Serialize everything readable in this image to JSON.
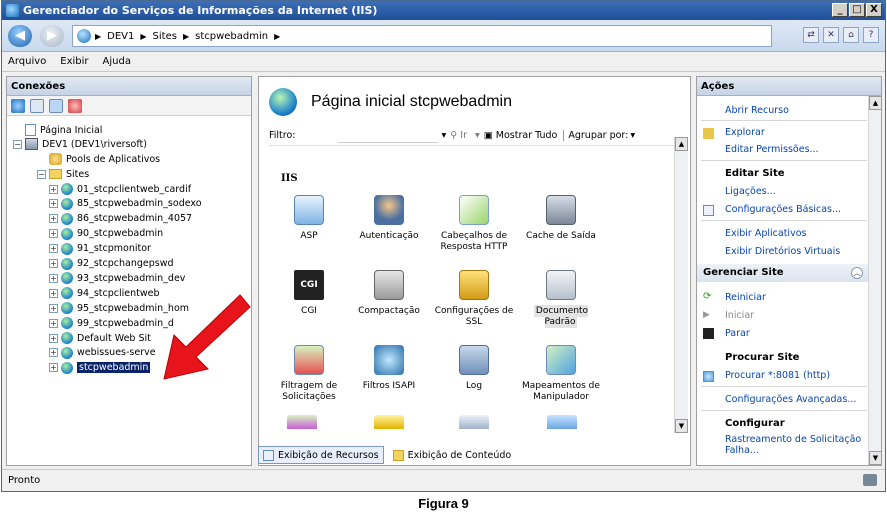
{
  "window": {
    "title": "Gerenciador do Serviços de Informações da Internet (IIS)",
    "controls": [
      "_",
      "□",
      "X"
    ]
  },
  "address": {
    "segments": [
      "DEV1",
      "Sites",
      "stcpwebadmin"
    ]
  },
  "menu": [
    "Arquivo",
    "Exibir",
    "Ajuda"
  ],
  "connections": {
    "title": "Conexões",
    "tree": {
      "start_page": "Página Inicial",
      "server": "DEV1 (DEV1\\riversoft)",
      "app_pools": "Pools de Aplicativos",
      "sites_folder": "Sites",
      "sites": [
        "01_stcpclientweb_cardif",
        "85_stcpwebadmin_sodexo",
        "86_stcpwebadmin_4057",
        "90_stcpwebadmin",
        "91_stcpmonitor",
        "92_stcpchangepswd",
        "93_stcpwebadmin_dev",
        "94_stcpclientweb",
        "95_stcpwebadmin_hom",
        "99_stcpwebadmin_d",
        "Default Web Sit",
        "webissues-serve",
        "stcpwebadmin"
      ],
      "selected": "stcpwebadmin"
    }
  },
  "center": {
    "title": "Página inicial stcpwebadmin",
    "filter_label": "Filtro:",
    "go_label": "Ir",
    "show_all_label": "Mostrar Tudo",
    "group_by_label": "Agrupar por:",
    "section": "IIS",
    "features": [
      {
        "label": "ASP",
        "icon": "asp-icon"
      },
      {
        "label": "Autenticação",
        "icon": "authentication-icon"
      },
      {
        "label": "Cabeçalhos de Resposta HTTP",
        "icon": "http-headers-icon"
      },
      {
        "label": "Cache de Saída",
        "icon": "output-cache-icon"
      },
      {
        "label": "CGI",
        "icon": "cgi-icon"
      },
      {
        "label": "Compactação",
        "icon": "compression-icon"
      },
      {
        "label": "Configurações de SSL",
        "icon": "ssl-lock-icon"
      },
      {
        "label": "Documento Padrão",
        "icon": "default-document-icon"
      },
      {
        "label": "Filtragem de Solicitações",
        "icon": "request-filtering-icon"
      },
      {
        "label": "Filtros ISAPI",
        "icon": "isapi-filters-icon"
      },
      {
        "label": "Log",
        "icon": "log-icon"
      },
      {
        "label": "Mapeamentos de Manipulador",
        "icon": "handler-mappings-icon"
      }
    ],
    "cgi_text": "CGI",
    "selected_feature": "Documento Padrão",
    "view_tabs": [
      "Exibição de Recursos",
      "Exibição de Conteúdo"
    ]
  },
  "actions": {
    "title": "Ações",
    "items": {
      "open_feature": "Abrir Recurso",
      "explore": "Explorar",
      "edit_permissions": "Editar Permissões...",
      "edit_site_head": "Editar Site",
      "bindings": "Ligações...",
      "basic_settings": "Configurações Básicas...",
      "view_apps": "Exibir Aplicativos",
      "view_vdirs": "Exibir Diretórios Virtuais",
      "manage_site_group": "Gerenciar Site",
      "restart": "Reiniciar",
      "start": "Iniciar",
      "stop": "Parar",
      "browse_site_head": "Procurar Site",
      "browse": "Procurar *:8081 (http)",
      "advanced_settings": "Configurações Avançadas...",
      "configure_head": "Configurar",
      "failed_request_tracing": "Rastreamento de Solicitação Falha..."
    }
  },
  "status": {
    "text": "Pronto"
  },
  "caption": "Figura 9",
  "colors": {
    "titlebar": "#1f4f9b",
    "link": "#0645ad",
    "selection": "#0a246a",
    "arrow": "#e8141b"
  }
}
